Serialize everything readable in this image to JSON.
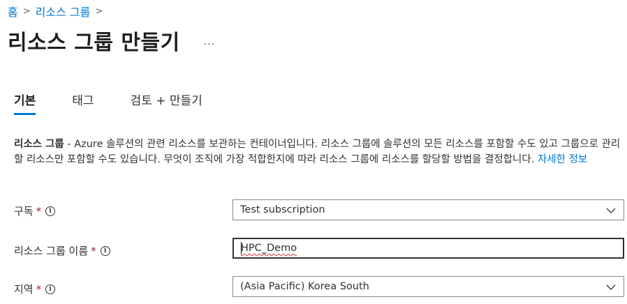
{
  "breadcrumb": {
    "items": [
      "홈",
      "리소스 그룹"
    ]
  },
  "page": {
    "title": "리소스 그룹 만들기",
    "more": "..."
  },
  "tabs": [
    {
      "label": "기본"
    },
    {
      "label": "태그"
    },
    {
      "label": "검토 + 만들기"
    }
  ],
  "description": {
    "term": "리소스 그룹",
    "text": " - Azure 솔루션의 관련 리소스를 보관하는 컨테이너입니다. 리소스 그룹에 솔루션의 모든 리소스를 포함할 수도 있고 그룹으로 관리할 리소스만 포함할 수도 있습니다. 무엇이 조직에 가장 적합한지에 따라 리소스 그룹에 리소스를 할당할 방법을 결정합니다. ",
    "link": "자세한 정보"
  },
  "fields": {
    "subscription": {
      "label": "구독",
      "required": "*",
      "value": "Test subscription"
    },
    "resource_group_name": {
      "label": "리소스 그룹 이름",
      "required": "*",
      "value": "HPC_Demo"
    },
    "region": {
      "label": "지역",
      "required": "*",
      "value": "(Asia Pacific) Korea South"
    }
  },
  "colors": {
    "accent": "#0078d4",
    "required": "#a4262c",
    "text": "#323130"
  },
  "icons": {
    "info": "i",
    "chevron": "chevron-down-icon"
  }
}
